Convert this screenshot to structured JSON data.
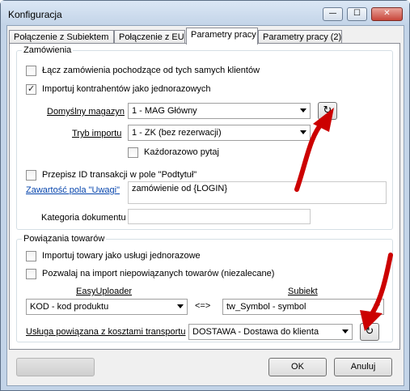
{
  "window": {
    "title": "Konfiguracja",
    "min": "—",
    "max": "☐",
    "close": "✕"
  },
  "tabs": [
    "Połączenie z Subiektem",
    "Połączenie z EU",
    "Parametry pracy",
    "Parametry pracy (2)"
  ],
  "zamowienia": {
    "group": "Zamówienia",
    "laczenie": "Łącz zamówienia pochodzące od tych samych klientów",
    "importuj": "Importuj kontrahentów jako jednorazowych",
    "magazyn_label": "Domyślny magazyn",
    "magazyn_value": "1 - MAG Główny",
    "tryb_label": "Tryb importu",
    "tryb_value": "1 - ZK (bez rezerwacji)",
    "pytaj": "Każdorazowo pytaj",
    "przepisz": "Przepisz ID transakcji w pole \"Podtytuł\"",
    "uwagi_label": "Zawartość pola \"Uwagi\"",
    "uwagi_value": "zamówienie od {LOGIN}",
    "kategoria_label": "Kategoria dokumentu",
    "kategoria_value": ""
  },
  "towary": {
    "group": "Powiązania towarów",
    "uslugi": "Importuj towary jako usługi jednorazowe",
    "niepowiazane": "Pozwalaj na import niepowiązanych towarów (niezalecane)",
    "eu_label": "EasyUploader",
    "sub_label": "Subiekt",
    "eu_value": "KOD - kod produktu",
    "mapping": "<=>",
    "sub_value": "tw_Symbol - symbol",
    "transport_label": "Usługa powiązana z kosztami transportu",
    "transport_value": "DOSTAWA - Dostawa do klienta"
  },
  "icons": {
    "refresh": "↻"
  },
  "buttons": {
    "ok": "OK",
    "cancel": "Anuluj",
    "progress": ""
  },
  "colors": {
    "arrow": "#cc0000",
    "link": "#0645ad"
  }
}
